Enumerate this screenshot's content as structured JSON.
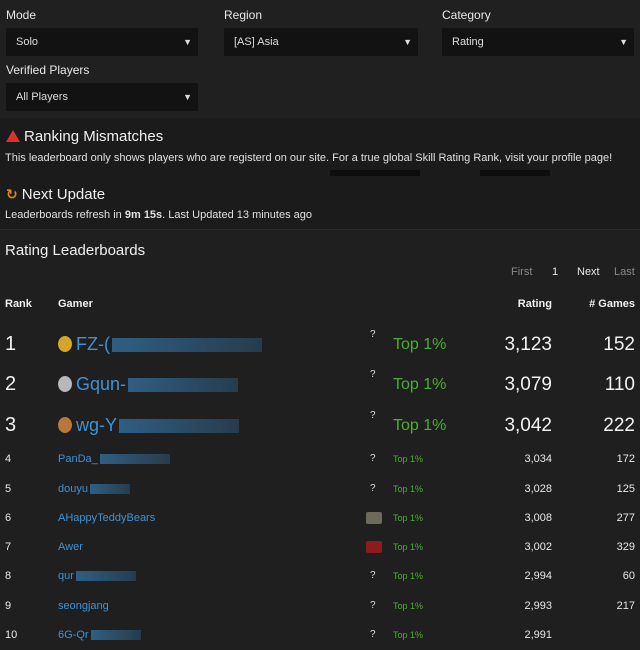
{
  "filters": {
    "mode": {
      "label": "Mode",
      "value": "Solo"
    },
    "region": {
      "label": "Region",
      "value": "[AS] Asia"
    },
    "category": {
      "label": "Category",
      "value": "Rating"
    },
    "verified": {
      "label": "Verified Players",
      "value": "All Players"
    }
  },
  "mismatch": {
    "title": "Ranking Mismatches",
    "text": "This leaderboard only shows players who are registerd on our site. For a true global Skill Rating Rank, visit your profile page!"
  },
  "update": {
    "title": "Next Update",
    "text_before": "Leaderboards refresh in ",
    "countdown": "9m 15s",
    "text_after": ". Last Updated 13 minutes ago"
  },
  "leaderboard": {
    "title": "Rating Leaderboards",
    "pager": {
      "first": "First",
      "page": "1",
      "next": "Next",
      "last": "Last"
    },
    "headers": {
      "rank": "Rank",
      "gamer": "Gamer",
      "rating": "Rating",
      "games": "# Games"
    },
    "rows": [
      {
        "rank": "1",
        "name": "FZ-(",
        "tier": "Top 1%",
        "rating": "3,123",
        "games": "152",
        "mark": "?",
        "medal": "gold"
      },
      {
        "rank": "2",
        "name": "Gqun-",
        "tier": "Top 1%",
        "rating": "3,079",
        "games": "110",
        "mark": "?",
        "medal": "silver"
      },
      {
        "rank": "3",
        "name": "wg-Y",
        "tier": "Top 1%",
        "rating": "3,042",
        "games": "222",
        "mark": "?",
        "medal": "bronze"
      },
      {
        "rank": "4",
        "name": "PanDa_",
        "tier": "Top 1%",
        "rating": "3,034",
        "games": "172",
        "mark": "?"
      },
      {
        "rank": "5",
        "name": "douyu",
        "tier": "Top 1%",
        "rating": "3,028",
        "games": "125",
        "mark": "?"
      },
      {
        "rank": "6",
        "name": "AHappyTeddyBears",
        "tier": "Top 1%",
        "rating": "3,008",
        "games": "277",
        "mark": ""
      },
      {
        "rank": "7",
        "name": "Awer",
        "tier": "Top 1%",
        "rating": "3,002",
        "games": "329",
        "mark": ""
      },
      {
        "rank": "8",
        "name": "qur",
        "tier": "Top 1%",
        "rating": "2,994",
        "games": "60",
        "mark": "?"
      },
      {
        "rank": "9",
        "name": "seongjang",
        "tier": "Top 1%",
        "rating": "2,993",
        "games": "217",
        "mark": "?"
      },
      {
        "rank": "10",
        "name": "6G-Qr",
        "tier": "Top 1%",
        "rating": "2,991",
        "games": "",
        "mark": "?"
      }
    ]
  },
  "colors": {
    "accent_link": "#3c93d6",
    "tier_green": "#4caf33",
    "warning_red": "#d9342b",
    "update_orange": "#e08a1e"
  }
}
